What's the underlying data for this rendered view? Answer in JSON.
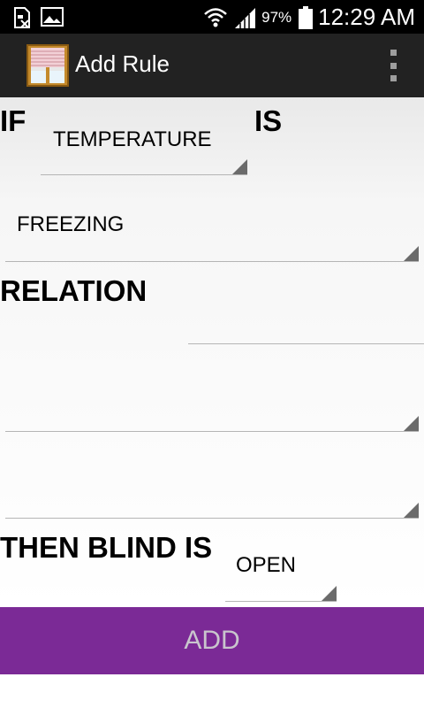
{
  "status_bar": {
    "battery_percent": "97%",
    "time": "12:29 AM"
  },
  "action_bar": {
    "title": "Add Rule",
    "app_icon": "window-blind-icon",
    "overflow_icon": "overflow-menu-icon"
  },
  "form": {
    "if_label": "IF",
    "is_label": "IS",
    "sensor_value": "TEMPERATURE",
    "condition_value": "FREEZING",
    "relation_label": "RELATION",
    "relation_value": "",
    "spinner_4_value": "",
    "spinner_5_value": "",
    "then_label": "THEN BLIND IS",
    "blind_value": "OPEN"
  },
  "actions": {
    "add_label": "ADD"
  },
  "colors": {
    "add_button_bg": "#7b2a96",
    "action_bar_bg": "#222222"
  }
}
